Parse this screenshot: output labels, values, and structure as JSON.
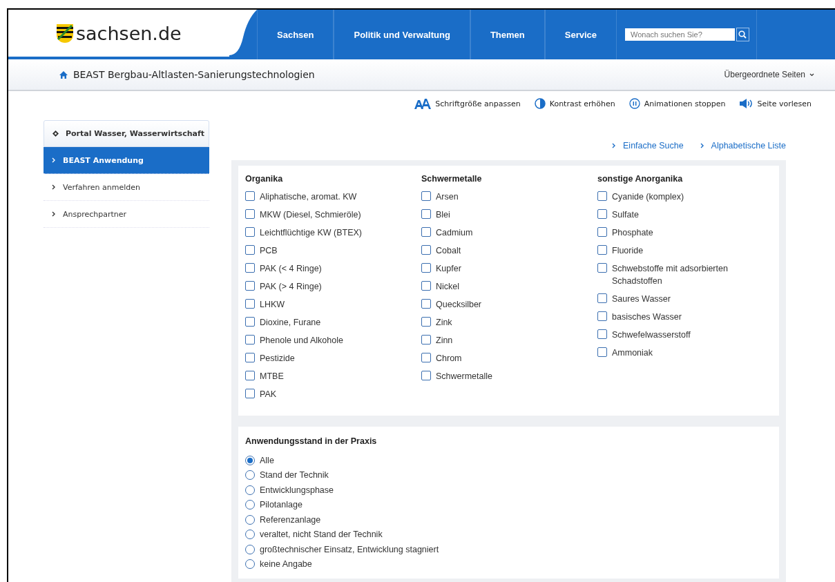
{
  "header": {
    "logo": "sachsen.de",
    "nav": [
      {
        "label": "Sachsen"
      },
      {
        "label": "Politik und Verwaltung"
      },
      {
        "label": "Themen"
      },
      {
        "label": "Service"
      }
    ],
    "search": {
      "placeholder": "Wonach suchen Sie?"
    }
  },
  "breadcrumb": {
    "title": "BEAST Bergbau-Altlasten-Sanierungstechnologien",
    "parent_pages": "Übergeordnete Seiten"
  },
  "tools": [
    {
      "kind": "font",
      "label": "Schriftgröße anpassen"
    },
    {
      "kind": "contrast",
      "label": "Kontrast erhöhen"
    },
    {
      "kind": "pause",
      "label": "Animationen stoppen"
    },
    {
      "kind": "speaker",
      "label": "Seite vorlesen"
    }
  ],
  "sidebar": {
    "items": [
      {
        "label": "Portal Wasser, Wasserwirtschaft",
        "kind": "portal",
        "selected": false
      },
      {
        "label": "BEAST Anwendung",
        "kind": "link",
        "selected": true
      },
      {
        "label": "Verfahren anmelden",
        "kind": "link",
        "selected": false
      },
      {
        "label": "Ansprechpartner",
        "kind": "link",
        "selected": false
      }
    ]
  },
  "links": [
    "Einfache Suche",
    "Alphabetische Liste"
  ],
  "categories": [
    {
      "title": "Organika",
      "options": [
        {
          "label": "Aliphatische, aromat. KW",
          "checked": false
        },
        {
          "label": "MKW (Diesel, Schmieröle)",
          "checked": false
        },
        {
          "label": "Leichtflüchtige KW (BTEX)",
          "checked": false
        },
        {
          "label": "PCB",
          "checked": false
        },
        {
          "label": "PAK (< 4 Ringe)",
          "checked": false
        },
        {
          "label": "PAK (> 4 Ringe)",
          "checked": false
        },
        {
          "label": "LHKW",
          "checked": false
        },
        {
          "label": "Dioxine, Furane",
          "checked": false
        },
        {
          "label": "Phenole und Alkohole",
          "checked": false
        },
        {
          "label": "Pestizide",
          "checked": false
        },
        {
          "label": "MTBE",
          "checked": false
        },
        {
          "label": "PAK",
          "checked": false
        }
      ]
    },
    {
      "title": "Schwermetalle",
      "options": [
        {
          "label": "Arsen",
          "checked": false
        },
        {
          "label": "Blei",
          "checked": false
        },
        {
          "label": "Cadmium",
          "checked": false
        },
        {
          "label": "Cobalt",
          "checked": false
        },
        {
          "label": "Kupfer",
          "checked": false
        },
        {
          "label": "Nickel",
          "checked": false
        },
        {
          "label": "Quecksilber",
          "checked": false
        },
        {
          "label": "Zink",
          "checked": false
        },
        {
          "label": "Zinn",
          "checked": false
        },
        {
          "label": "Chrom",
          "checked": false
        },
        {
          "label": "Schwermetalle",
          "checked": false
        }
      ]
    },
    {
      "title": "sonstige Anorganika",
      "options": [
        {
          "label": "Cyanide (komplex)",
          "checked": false
        },
        {
          "label": "Sulfate",
          "checked": false
        },
        {
          "label": "Phosphate",
          "checked": false
        },
        {
          "label": "Fluoride",
          "checked": false
        },
        {
          "label": "Schwebstoffe mit adsorbierten Schadstoffen",
          "checked": false
        },
        {
          "label": "Saures Wasser",
          "checked": false
        },
        {
          "label": "basisches Wasser",
          "checked": false
        },
        {
          "label": "Schwefelwasserstoff",
          "checked": false
        },
        {
          "label": "Ammoniak",
          "checked": false
        }
      ]
    }
  ],
  "practice": {
    "title": "Anwendungsstand in der Praxis",
    "options": [
      {
        "label": "Alle",
        "selected": true
      },
      {
        "label": "Stand der Technik",
        "selected": false
      },
      {
        "label": "Entwicklungsphase",
        "selected": false
      },
      {
        "label": "Pilotanlage",
        "selected": false
      },
      {
        "label": "Referenzanlage",
        "selected": false
      },
      {
        "label": "veraltet, nicht Stand der Technik",
        "selected": false
      },
      {
        "label": "großtechnischer Einsatz, Entwicklung stagniert",
        "selected": false
      },
      {
        "label": "keine Angabe",
        "selected": false
      }
    ]
  }
}
